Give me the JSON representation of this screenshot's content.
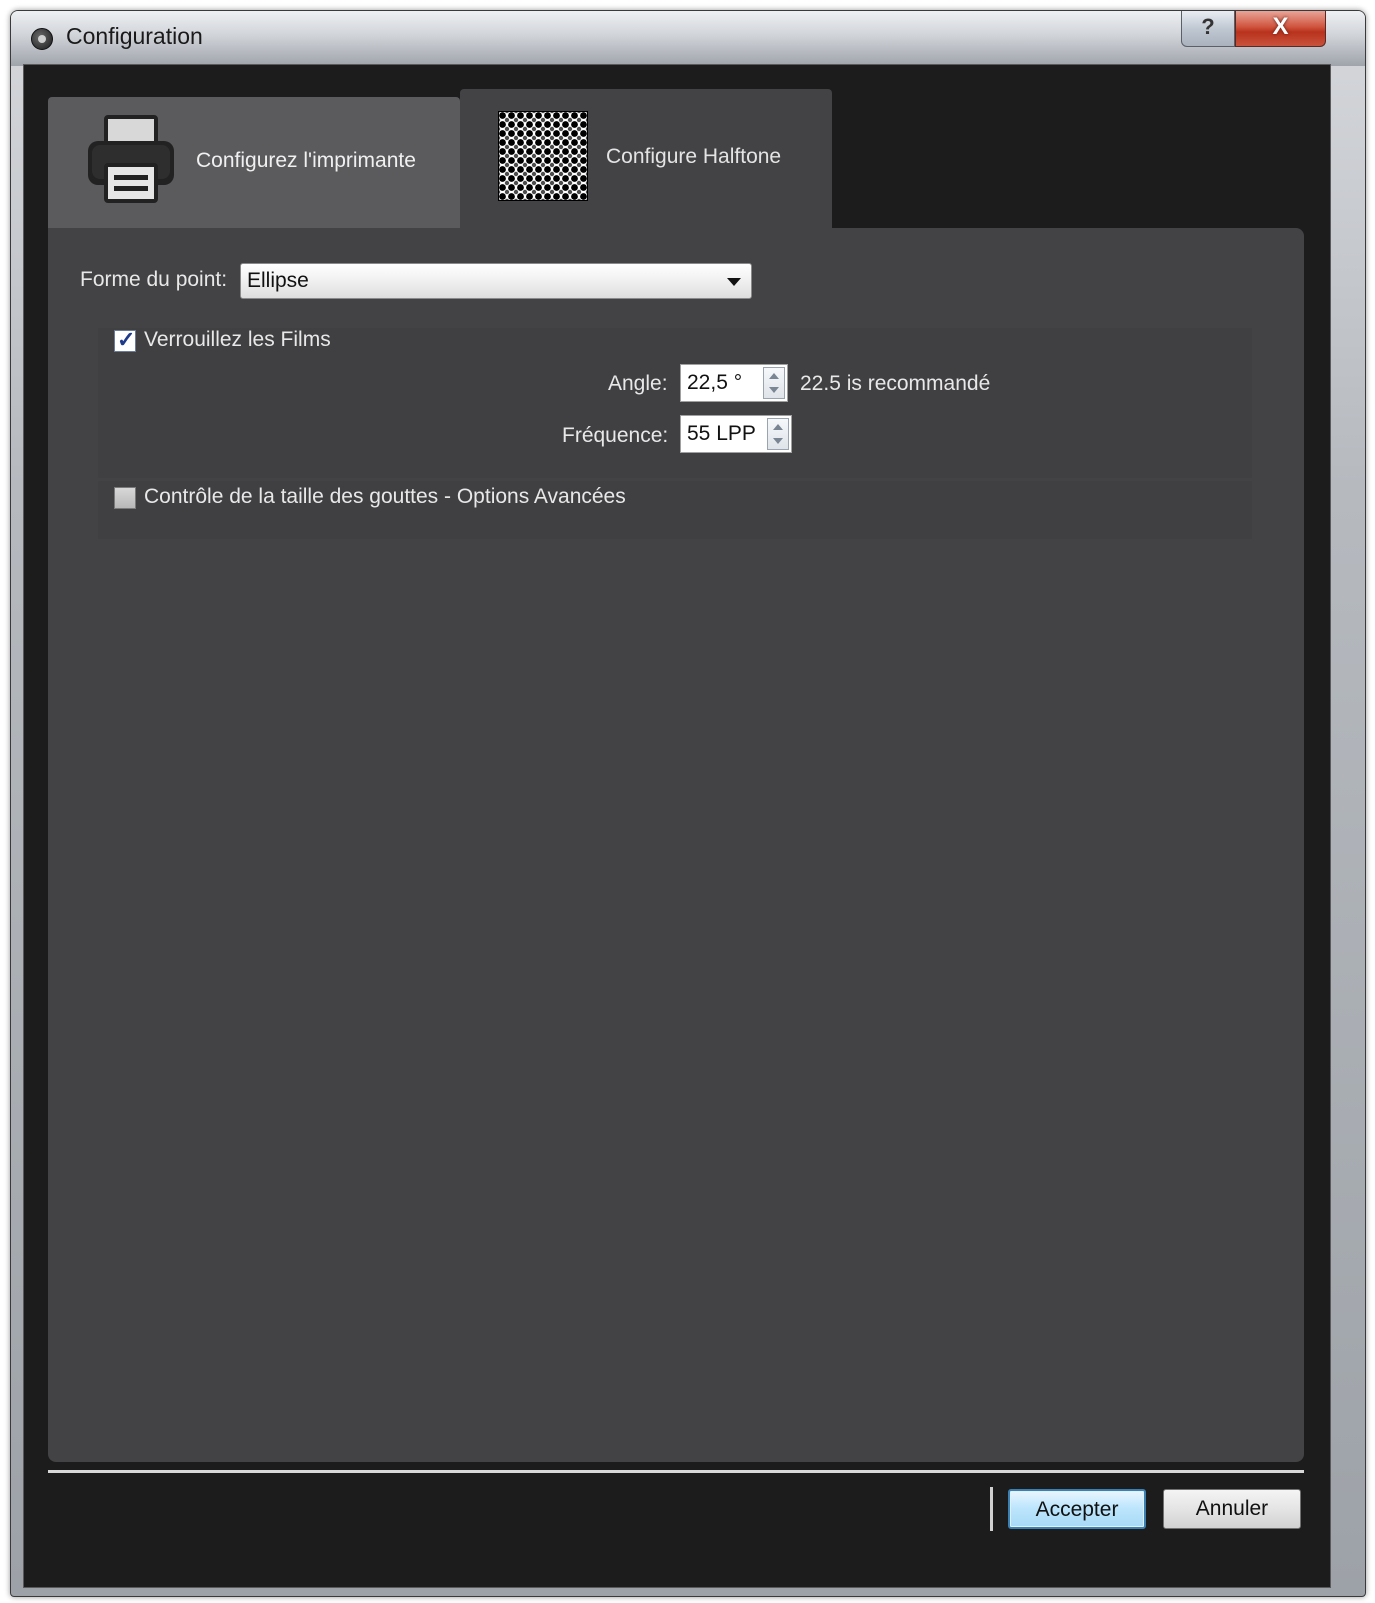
{
  "window": {
    "title": "Configuration",
    "help_label": "?",
    "close_label": "X"
  },
  "tabs": [
    {
      "label": "Configurez l'imprimante",
      "icon": "printer-icon",
      "active": false
    },
    {
      "label": "Configure Halftone",
      "icon": "halftone-pattern-icon",
      "active": true
    }
  ],
  "form": {
    "dot_shape_label": "Forme du point:",
    "dot_shape_value": "Ellipse",
    "lock_films_label": "Verrouillez les Films",
    "lock_films_checked": true,
    "angle_label": "Angle:",
    "angle_value": "22,5 °",
    "angle_hint": "22.5 is recommandé",
    "frequency_label": "Fréquence:",
    "frequency_value": "55 LPP",
    "drop_size_label": "Contrôle de la taille des gouttes - Options Avancées",
    "drop_size_checked": false
  },
  "buttons": {
    "accept": "Accepter",
    "cancel": "Annuler"
  },
  "colors": {
    "panel": "#434245",
    "frame": "#1c1c1c",
    "accent": "#3c7fb1"
  }
}
